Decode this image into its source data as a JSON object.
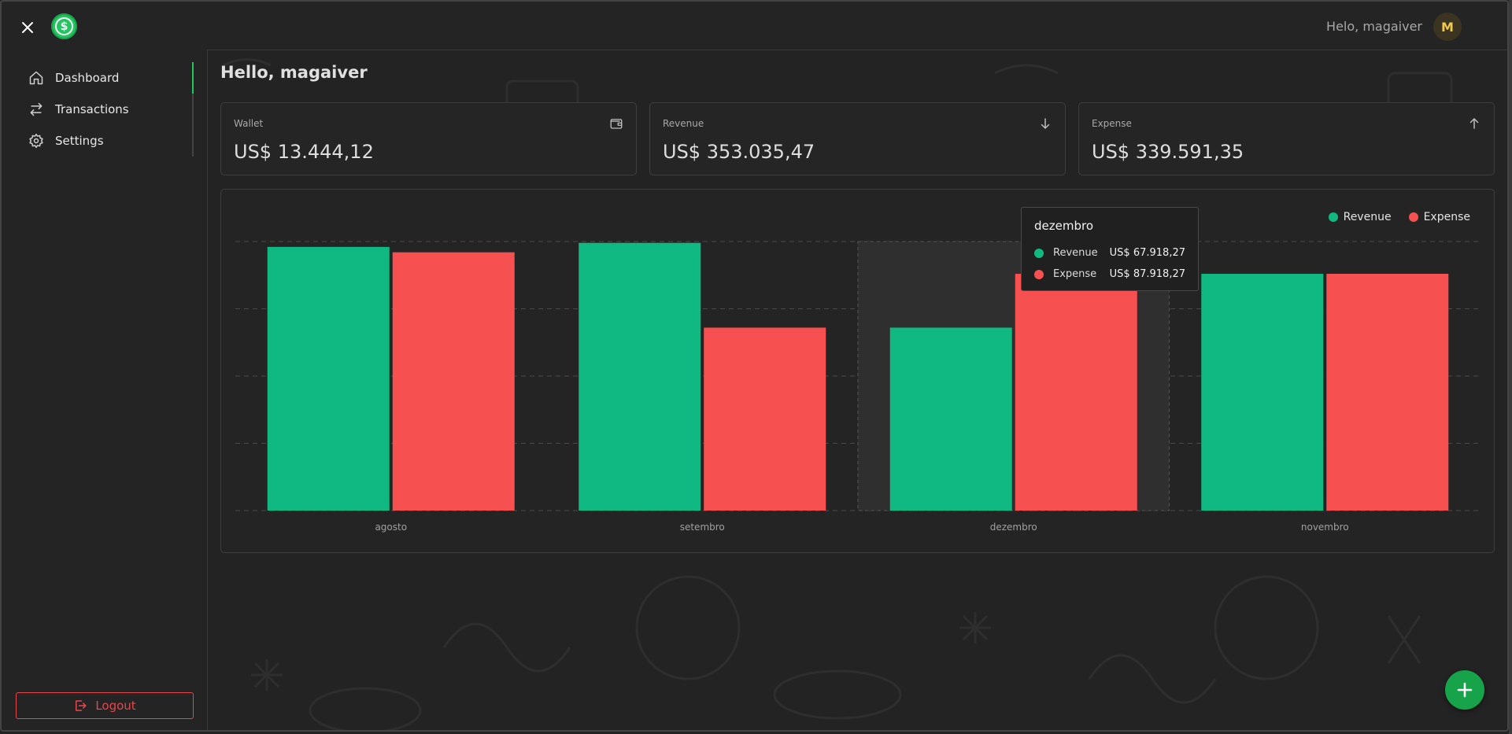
{
  "colors": {
    "accent": "#16a34a",
    "revenue": "#10b981",
    "expense": "#f75050",
    "logout": "#e5484d"
  },
  "header": {
    "greeting": "Helo, magaiver",
    "avatar_initial": "M"
  },
  "sidebar": {
    "items": [
      {
        "label": "Dashboard",
        "icon": "home-icon"
      },
      {
        "label": "Transactions",
        "icon": "arrows-exchange-icon"
      },
      {
        "label": "Settings",
        "icon": "gear-icon"
      }
    ],
    "logout_label": "Logout"
  },
  "main": {
    "title": "Hello, magaiver",
    "cards": [
      {
        "label": "Wallet",
        "value": "US$ 13.444,12",
        "icon": "wallet-icon"
      },
      {
        "label": "Revenue",
        "value": "US$ 353.035,47",
        "icon": "arrow-down-icon"
      },
      {
        "label": "Expense",
        "value": "US$ 339.591,35",
        "icon": "arrow-up-icon"
      }
    ]
  },
  "tooltip": {
    "title": "dezembro",
    "rows": [
      {
        "name": "Revenue",
        "value": "US$ 67.918,27"
      },
      {
        "name": "Expense",
        "value": "US$ 87.918,27"
      }
    ]
  },
  "chart_data": {
    "type": "bar",
    "categories": [
      "agosto",
      "setembro",
      "dezembro",
      "novembro"
    ],
    "series": [
      {
        "name": "Revenue",
        "values": [
          98000,
          99500,
          68000,
          88000
        ]
      },
      {
        "name": "Expense",
        "values": [
          96000,
          68000,
          88000,
          88000
        ]
      }
    ],
    "ylim": [
      0,
      100000
    ],
    "grid": true,
    "legend": "top-right",
    "highlighted_category": "dezembro"
  }
}
